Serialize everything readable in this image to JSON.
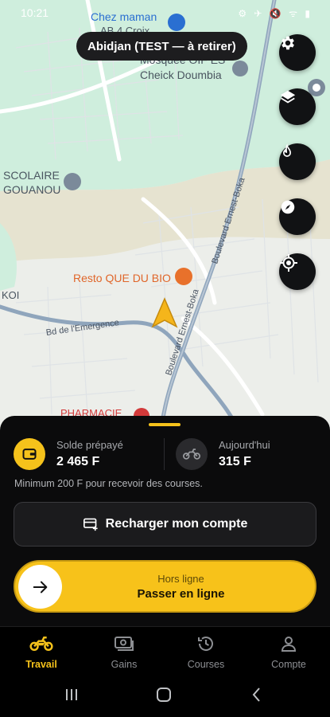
{
  "status_bar": {
    "time": "10:21",
    "icons": "⚙ ✈ 🔇 ᯤ ▮"
  },
  "map": {
    "city_chip": "Abidjan (TEST — à retirer)",
    "labels": {
      "poi_top": "Chez maman",
      "poi_top_sub": "AB  4 Croix",
      "mosque_line1": "Mosquée OIF ES",
      "mosque_line2": "Cheick Doumbia",
      "school_line1": "SCOLAIRE",
      "school_line2": "GOUANOU",
      "resto": "Resto QUE DU BIO",
      "koi": "KOI",
      "road_emergence": "Bd de l'Emergence",
      "road_boka_1": "Boulevard Ernest-Boka",
      "road_boka_2": "Boulevard Ernest-Boka",
      "pharmacy": "PHARMACIE"
    },
    "fab_icons": [
      "gear-icon",
      "layers-icon",
      "flame-icon",
      "compass-icon",
      "locate-icon"
    ]
  },
  "sheet": {
    "balance_label": "Solde prépayé",
    "balance_value": "2 465 F",
    "today_label": "Aujourd'hui",
    "today_value": "315 F",
    "hint": "Minimum 200 F pour recevoir des courses.",
    "recharge_label": "Recharger mon compte",
    "status_label": "Hors ligne",
    "go_online_label": "Passer en ligne"
  },
  "nav": {
    "items": [
      {
        "label": "Travail",
        "icon": "motorcycle-icon",
        "active": true
      },
      {
        "label": "Gains",
        "icon": "money-icon",
        "active": false
      },
      {
        "label": "Courses",
        "icon": "history-icon",
        "active": false
      },
      {
        "label": "Compte",
        "icon": "user-icon",
        "active": false
      }
    ]
  },
  "colors": {
    "accent": "#F5C21B",
    "sheet_bg": "#0B0B0C",
    "map_bg": "#ECEEEA",
    "road_blue": "#8FA5BC"
  }
}
